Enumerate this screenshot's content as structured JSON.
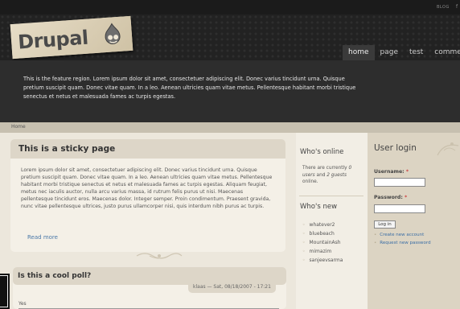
{
  "topbar": {
    "blog": "BLOG",
    "extra": "f"
  },
  "logo": {
    "text": "Drupal"
  },
  "nav": {
    "items": [
      "home",
      "page",
      "test",
      "commer"
    ]
  },
  "feature": {
    "text": "This is the feature region. Lorem ipsum dolor sit amet, consectetuer adipiscing elit. Donec varius tincidunt urna. Quisque pretium suscipit quam. Donec vitae quam. In a leo. Aenean ultricies quam vitae metus. Pellentesque habitant morbi tristique senectus et netus et malesuada fames ac turpis egestas."
  },
  "breadcrumb": {
    "home": "Home"
  },
  "sticky": {
    "title": "This is a sticky page",
    "body": "Lorem ipsum dolor sit amet, consectetuer adipiscing elit. Donec varius tincidunt urna. Quisque pretium suscipit quam. Donec vitae quam. In a leo. Aenean ultricies quam vitae metus. Pellentesque habitant morbi tristique senectus et netus et malesuada fames ac turpis egestas. Aliquam feugiat, metus nec iaculis auctor, nulla arcu varius massa, id rutrum felis purus ut nisi. Maecenas pellentesque tincidunt eros. Maecenas dolor. Integer semper. Proin condimentum. Praesent gravida, nunc vitae pellentesque ultrices, justo purus ullamcorper nisi, quis interdum nibh purus ac turpis.",
    "read_more": "Read more"
  },
  "poll": {
    "title": "Is this a cool poll?",
    "submitted": "klaas — Sat, 08/18/2007 - 17:21",
    "option": "Yes"
  },
  "whos_online": {
    "title": "Who's online",
    "text_pre": "There are currently ",
    "text_em": "0 users",
    "text_mid": " and ",
    "text_em2": "2 guests",
    "text_post": " online."
  },
  "whos_new": {
    "title": "Who's new",
    "users": [
      "whatever2",
      "bluebeach",
      "MountainAsh",
      "mimazim",
      "sanjeevsarma"
    ]
  },
  "login": {
    "title": "User login",
    "username_label": "Username:",
    "password_label": "Password:",
    "required": "*",
    "button": "Log in",
    "links": [
      "Create new account",
      "Request new password"
    ]
  }
}
